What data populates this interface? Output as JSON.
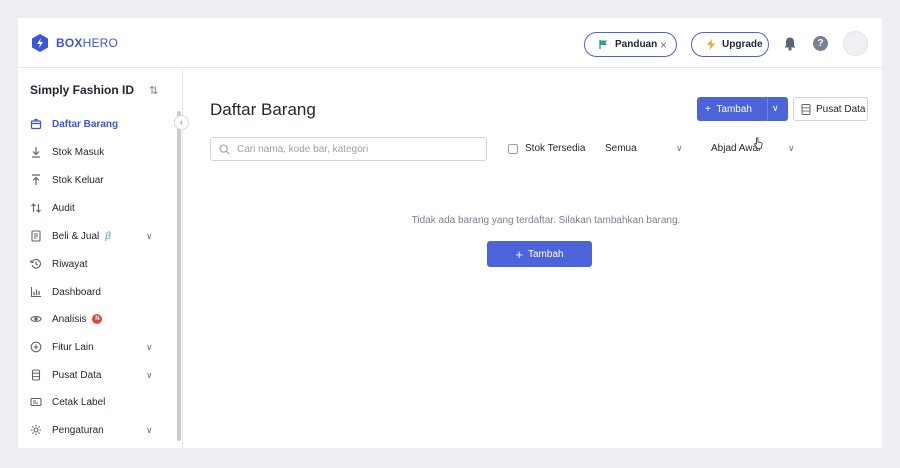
{
  "app": {
    "logo_bold": "BOX",
    "logo_light": "HERO",
    "brand_color": "#3b56d6"
  },
  "header": {
    "guide_label": "Panduan",
    "upgrade_label": "Upgrade"
  },
  "sidebar": {
    "store_name": "Simply Fashion ID",
    "items": [
      {
        "label": "Daftar Barang",
        "icon": "box-icon",
        "active": true
      },
      {
        "label": "Stok Masuk",
        "icon": "arrow-down-icon"
      },
      {
        "label": "Stok Keluar",
        "icon": "arrow-up-icon"
      },
      {
        "label": "Audit",
        "icon": "swap-icon"
      },
      {
        "label": "Beli & Jual",
        "icon": "receipt-icon",
        "badge": "β",
        "expandable": true
      },
      {
        "label": "Riwayat",
        "icon": "history-icon"
      },
      {
        "label": "Dashboard",
        "icon": "bar-chart-icon"
      },
      {
        "label": "Analisis",
        "icon": "eye-icon",
        "badge": "N"
      },
      {
        "label": "Fitur Lain",
        "icon": "plus-circle-icon",
        "expandable": true
      },
      {
        "label": "Pusat Data",
        "icon": "database-icon",
        "expandable": true
      },
      {
        "label": "Cetak Label",
        "icon": "label-icon"
      },
      {
        "label": "Pengaturan",
        "icon": "gear-icon",
        "expandable": true
      }
    ]
  },
  "main": {
    "title": "Daftar Barang",
    "add_button": "Tambah",
    "data_center_button": "Pusat Data",
    "search_placeholder": "Cari nama, kode bar, kategori",
    "in_stock_label": "Stok Tersedia",
    "filter_select": "Semua",
    "sort_select": "Abjad Awal",
    "empty_message": "Tidak ada barang yang terdaftar. Silakan tambahkan barang.",
    "empty_add_button": "Tambah"
  }
}
